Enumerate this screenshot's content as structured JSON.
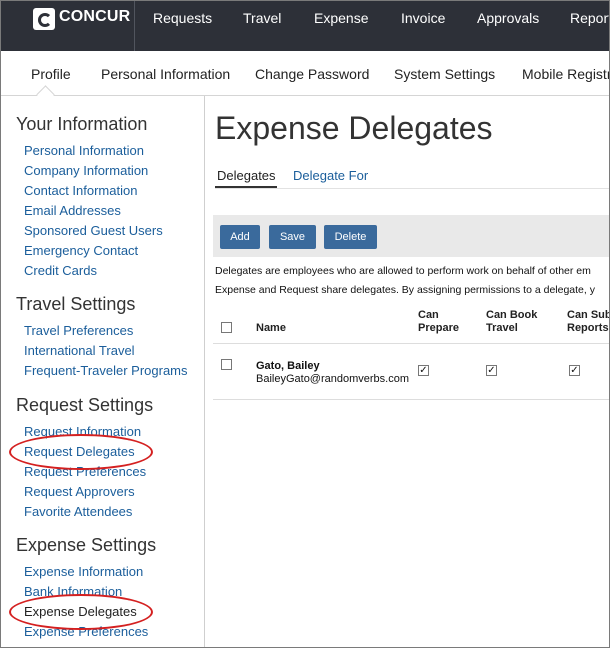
{
  "brand": {
    "name": "CONCUR"
  },
  "top_nav": [
    "Requests",
    "Travel",
    "Expense",
    "Invoice",
    "Approvals",
    "Report"
  ],
  "sub_nav": [
    "Profile",
    "Personal Information",
    "Change Password",
    "System Settings",
    "Mobile Registra"
  ],
  "sidebar": {
    "your_information": {
      "heading": "Your Information",
      "links": [
        "Personal Information",
        "Company Information",
        "Contact Information",
        "Email Addresses",
        "Sponsored Guest Users",
        "Emergency Contact",
        "Credit Cards"
      ]
    },
    "travel_settings": {
      "heading": "Travel Settings",
      "links": [
        "Travel Preferences",
        "International Travel",
        "Frequent-Traveler Programs"
      ]
    },
    "request_settings": {
      "heading": "Request Settings",
      "links": [
        "Request Information",
        "Request Delegates",
        "Request Preferences",
        "Request Approvers",
        "Favorite Attendees"
      ]
    },
    "expense_settings": {
      "heading": "Expense Settings",
      "links": [
        "Expense Information",
        "Bank Information",
        "Expense Delegates",
        "Expense Preferences"
      ]
    }
  },
  "main": {
    "title": "Expense Delegates",
    "tabs": [
      "Delegates",
      "Delegate For"
    ],
    "buttons": {
      "add": "Add",
      "save": "Save",
      "delete": "Delete"
    },
    "description": [
      "Delegates are employees who are allowed to perform work on behalf of other em",
      "Expense and Request share delegates. By assigning permissions to a delegate, y"
    ],
    "table": {
      "headers": {
        "name": "Name",
        "can_prepare": [
          "Can",
          "Prepare"
        ],
        "can_book_travel": [
          "Can Book",
          "Travel"
        ],
        "can_submit_reports": [
          "Can Sub",
          "Reports"
        ]
      },
      "rows": [
        {
          "name": "Gato, Bailey",
          "email": "BaileyGato@randomverbs.com",
          "can_prepare": true,
          "can_book_travel": true,
          "can_submit_reports": true
        }
      ]
    }
  },
  "colors": {
    "topbar": "#2d3038",
    "link": "#1b5e9b",
    "button": "#3a6a9c",
    "highlight_circle": "#d42020"
  }
}
